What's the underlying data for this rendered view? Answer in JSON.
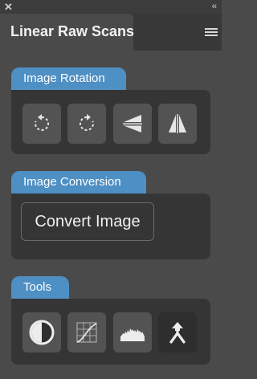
{
  "window": {
    "close_glyph": "✕",
    "collapse_glyph": "‹‹"
  },
  "panel": {
    "title": "Linear Raw Scans"
  },
  "sections": {
    "rotation": {
      "title": "Image Rotation"
    },
    "conversion": {
      "title": "Image Conversion",
      "button_label": "Convert Image"
    },
    "tools": {
      "title": "Tools"
    }
  },
  "icons": {
    "rotation_buttons": [
      "rotate-counterclockwise-icon",
      "rotate-clockwise-icon",
      "flip-vertical-icon",
      "flip-horizontal-icon"
    ],
    "tool_buttons": [
      "contrast-icon",
      "curves-icon",
      "histogram-icon",
      "merge-arrows-icon"
    ]
  },
  "colors": {
    "accent": "#4e8fc4",
    "panel_bg": "#4a4a4a",
    "section_bg": "#353535",
    "button_bg": "#535353"
  }
}
